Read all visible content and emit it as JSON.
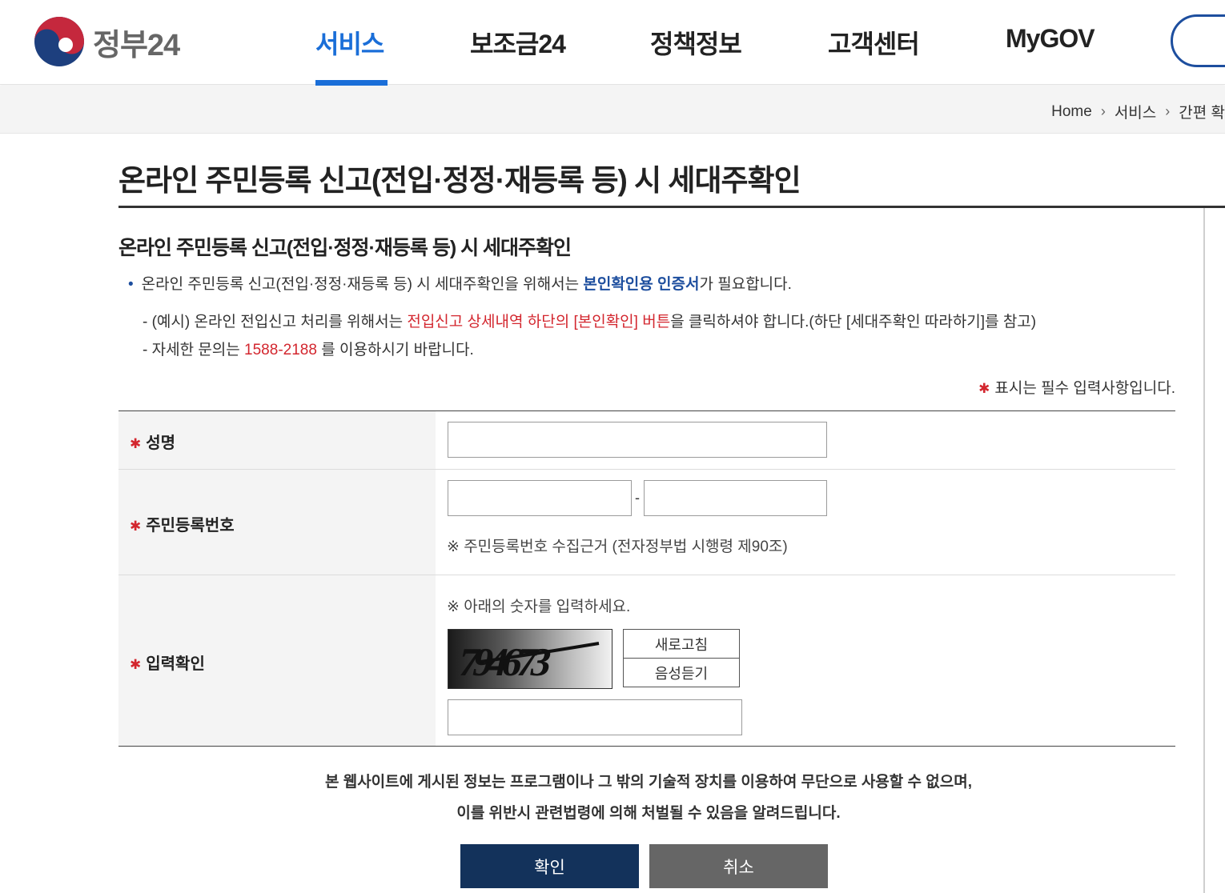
{
  "colors": {
    "primary_blue": "#1a6ed8",
    "navy": "#13325b",
    "required_red": "#d3262e",
    "logo_red": "#c5283d",
    "logo_blue": "#1d3f7e",
    "cancel_gray": "#666666"
  },
  "header": {
    "logo_text": "정부24",
    "logo_icon": "government-taegeuk-icon",
    "nav": [
      {
        "label": "서비스",
        "active": true
      },
      {
        "label": "보조금24",
        "active": false
      },
      {
        "label": "정책정보",
        "active": false
      },
      {
        "label": "고객센터",
        "active": false
      },
      {
        "label": "MyGOV",
        "active": false
      }
    ]
  },
  "breadcrumb": [
    "Home",
    "서비스",
    "간편 확"
  ],
  "page": {
    "title": "온라인 주민등록 신고(전입·정정·재등록 등) 시 세대주확인",
    "subtitle": "온라인 주민등록 신고(전입·정정·재등록 등) 시 세대주확인"
  },
  "info": {
    "bullet_prefix": "온라인 주민등록 신고(전입·정정·재등록 등) 시 세대주확인을 위해서는 ",
    "bullet_emphasis": "본인확인용 인증서",
    "bullet_suffix": "가 필요합니다.",
    "example_prefix": "- (예시) 온라인 전입신고 처리를 위해서는 ",
    "example_emphasis": "전입신고 상세내역 하단의 [본인확인] 버튼",
    "example_suffix": "을 클릭하셔야 합니다.(하단 [세대주확인 따라하기]를 참고)",
    "contact_prefix": "- 자세한 문의는 ",
    "contact_phone": "1588-2188",
    "contact_suffix": " 를 이용하시기 바랍니다.",
    "required_note": "표시는 필수 입력사항입니다."
  },
  "form": {
    "required_mark": "*",
    "name_label": "성명",
    "name_value": "",
    "rrn_label": "주민등록번호",
    "rrn_front_value": "",
    "rrn_back_value": "",
    "rrn_separator": "-",
    "rrn_note": "※ 주민등록번호 수집근거 (전자정부법 시행령 제90조)",
    "captcha_label": "입력확인",
    "captcha_note": "※ 아래의 숫자를 입력하세요.",
    "captcha_text": "794673",
    "refresh_label": "새로고침",
    "audio_label": "음성듣기",
    "captcha_value": ""
  },
  "notice": {
    "line1": "본 웹사이트에 게시된 정보는 프로그램이나 그 밖의 기술적 장치를 이용하여 무단으로 사용할 수 없으며,",
    "line2": "이를 위반시 관련법령에 의해 처벌될 수 있음을 알려드립니다."
  },
  "buttons": {
    "confirm": "확인",
    "cancel": "취소"
  }
}
